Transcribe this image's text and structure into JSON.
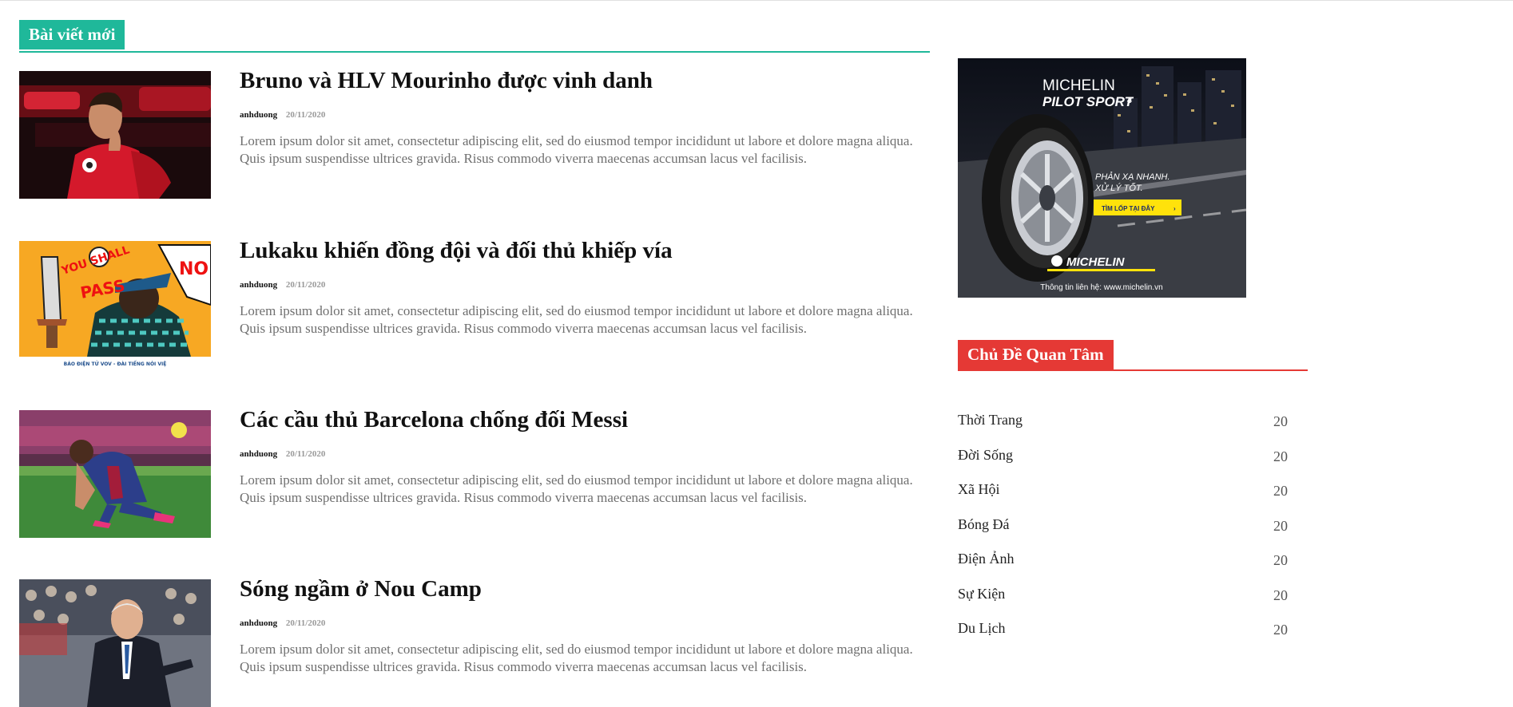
{
  "section": {
    "title": "Bài viết mới",
    "accent": "#1fb89a"
  },
  "posts": [
    {
      "title": "Bruno và HLV Mourinho được vinh danh",
      "author": "anhduong",
      "date": "20/11/2020",
      "excerpt": "Lorem ipsum dolor sit amet, consectetur adipiscing elit, sed do eiusmod tempor incididunt ut labore et dolore magna aliqua. Quis ipsum suspendisse ultrices gravida. Risus commodo viverra maecenas accumsan lacus vel facilisis."
    },
    {
      "title": "Lukaku khiến đồng đội và đối thủ khiếp vía",
      "author": "anhduong",
      "date": "20/11/2020",
      "excerpt": "Lorem ipsum dolor sit amet, consectetur adipiscing elit, sed do eiusmod tempor incididunt ut labore et dolore magna aliqua. Quis ipsum suspendisse ultrices gravida. Risus commodo viverra maecenas accumsan lacus vel facilisis.",
      "thumb_text": {
        "shout_1": "YOU SHALL",
        "shout_2": "PASS",
        "bubble": "NO",
        "caption": "BÁO ĐIỆN TỬ VOV - ĐÀI TIẾNG NÓI VIỆ"
      }
    },
    {
      "title": "Các cầu thủ Barcelona chống đối Messi",
      "author": "anhduong",
      "date": "20/11/2020",
      "excerpt": "Lorem ipsum dolor sit amet, consectetur adipiscing elit, sed do eiusmod tempor incididunt ut labore et dolore magna aliqua. Quis ipsum suspendisse ultrices gravida. Risus commodo viverra maecenas accumsan lacus vel facilisis."
    },
    {
      "title": "Sóng ngầm ở Nou Camp",
      "author": "anhduong",
      "date": "20/11/2020",
      "excerpt": "Lorem ipsum dolor sit amet, consectetur adipiscing elit, sed do eiusmod tempor incididunt ut labore et dolore magna aliqua. Quis ipsum suspendisse ultrices gravida. Risus commodo viverra maecenas accumsan lacus vel facilisis."
    }
  ],
  "ad": {
    "brand": "MICHELIN",
    "product": "PILOT SPORT",
    "product_num": "4",
    "tagline_1": "PHẢN XẠ NHANH.",
    "tagline_2": "XỬ LÝ TỐT.",
    "cta": "TÌM LỐP TẠI ĐÂY",
    "logo": "MICHELIN",
    "contact": "Thông tin liên hệ: www.michelin.vn"
  },
  "topics_widget": {
    "title": "Chủ Đề Quan Tâm",
    "accent": "#e53935",
    "items": [
      {
        "name": "Thời Trang",
        "count": "20"
      },
      {
        "name": "Đời Sống",
        "count": "20"
      },
      {
        "name": "Xã Hội",
        "count": "20"
      },
      {
        "name": "Bóng Đá",
        "count": "20"
      },
      {
        "name": "Điện Ảnh",
        "count": "20"
      },
      {
        "name": "Sự Kiện",
        "count": "20"
      },
      {
        "name": "Du Lịch",
        "count": "20"
      }
    ]
  }
}
